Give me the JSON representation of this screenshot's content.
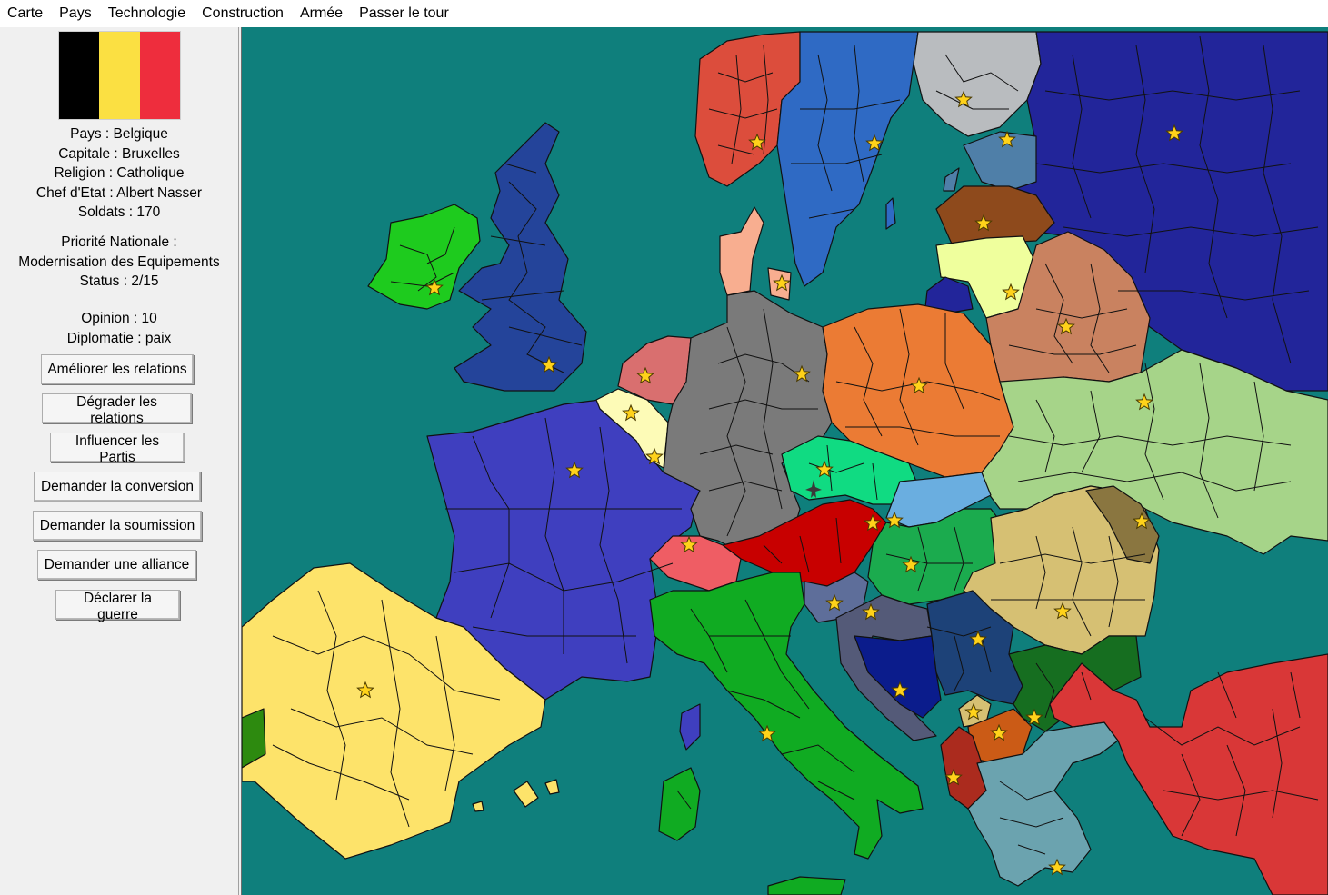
{
  "menu": [
    "Carte",
    "Pays",
    "Technologie",
    "Construction",
    "Armée",
    "Passer le tour"
  ],
  "country": {
    "flag_colors": [
      "#000000",
      "#fbe042",
      "#ee2d3d"
    ],
    "pays": "Pays : Belgique",
    "capitale": "Capitale : Bruxelles",
    "religion": "Religion : Catholique",
    "chef": "Chef d'Etat : Albert Nasser",
    "soldats": "Soldats : 170",
    "priorite_label": "Priorité Nationale :",
    "priorite_value": "Modernisation des Equipements",
    "status": "Status : 2/15",
    "opinion": "Opinion : 10",
    "diplomatie": "Diplomatie : paix"
  },
  "actions": {
    "ameliorer": "Améliorer les relations",
    "degrader": "Dégrader les relations",
    "influencer": "Influencer les Partis",
    "conversion": "Demander la conversion",
    "soumission": "Demander la soumission",
    "alliance": "Demander une alliance",
    "guerre": "Déclarer la guerre"
  },
  "map": {
    "sea_color": "#0f7f7c",
    "countries": [
      {
        "name": "spain-icon",
        "color": "#fde36a"
      },
      {
        "name": "portugal",
        "color": "#2d8a0f"
      },
      {
        "name": "france",
        "color": "#3f3fbf"
      },
      {
        "name": "uk",
        "color": "#24449a"
      },
      {
        "name": "ireland",
        "color": "#1ecb1e"
      },
      {
        "name": "belgium",
        "color": "#fdfbb7"
      },
      {
        "name": "netherlands",
        "color": "#d96f6f"
      },
      {
        "name": "germany",
        "color": "#7a7a7a"
      },
      {
        "name": "denmark",
        "color": "#f8ae90"
      },
      {
        "name": "norway",
        "color": "#dc4d3c"
      },
      {
        "name": "sweden",
        "color": "#2f6ac4"
      },
      {
        "name": "finland",
        "color": "#b9bcbf"
      },
      {
        "name": "russia",
        "color": "#22259a"
      },
      {
        "name": "estonia",
        "color": "#4f7fa8"
      },
      {
        "name": "latvia",
        "color": "#8e4a1c"
      },
      {
        "name": "lithuania",
        "color": "#efff9d"
      },
      {
        "name": "belarus",
        "color": "#c98260"
      },
      {
        "name": "poland",
        "color": "#eb7b34"
      },
      {
        "name": "ukraine",
        "color": "#a6d489"
      },
      {
        "name": "czechia",
        "color": "#10db82"
      },
      {
        "name": "slovakia",
        "color": "#6aaee0"
      },
      {
        "name": "austria",
        "color": "#c80000"
      },
      {
        "name": "switzerland",
        "color": "#ef5d64"
      },
      {
        "name": "hungary",
        "color": "#1bab4e"
      },
      {
        "name": "romania",
        "color": "#d6c073"
      },
      {
        "name": "moldova",
        "color": "#8a7640"
      },
      {
        "name": "italy",
        "color": "#10ab22"
      },
      {
        "name": "slovenia",
        "color": "#5e6e9a"
      },
      {
        "name": "croatia",
        "color": "#545a78"
      },
      {
        "name": "bosnia",
        "color": "#0b1c8c"
      },
      {
        "name": "serbia",
        "color": "#1d4278"
      },
      {
        "name": "bulgaria",
        "color": "#166e20"
      },
      {
        "name": "macedonia",
        "color": "#cb5b16"
      },
      {
        "name": "albania",
        "color": "#ab2b1e"
      },
      {
        "name": "greece",
        "color": "#6ba3af"
      },
      {
        "name": "turkey",
        "color": "#d93737"
      }
    ]
  }
}
